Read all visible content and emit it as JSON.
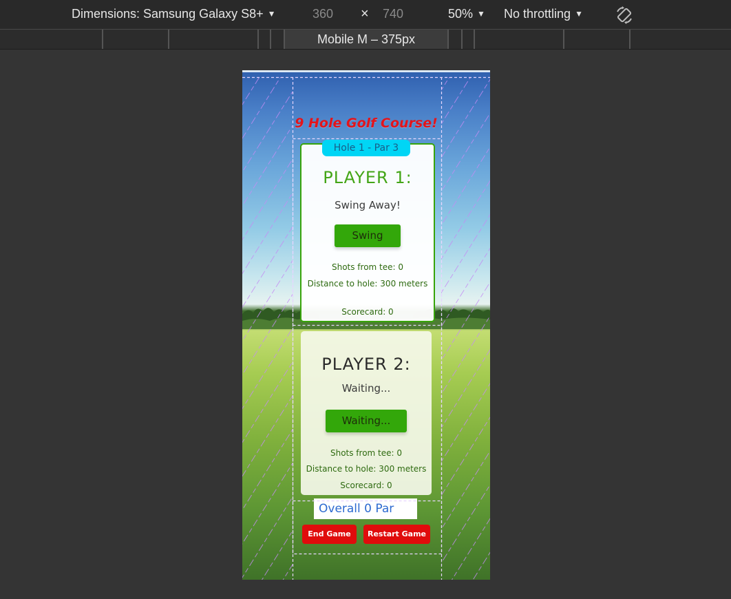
{
  "toolbar": {
    "dimensions_label": "Dimensions: Samsung Galaxy S8+",
    "width_value": "360",
    "times": "×",
    "height_value": "740",
    "zoom": "50%",
    "throttling": "No throttling",
    "rotate_icon": "rotate-icon"
  },
  "media_bar": {
    "active_label": "Mobile M – 375px"
  },
  "game": {
    "title": "9 Hole Golf Course!",
    "hole_label": "Hole 1 - Par 3",
    "player1": {
      "name": "PLAYER 1:",
      "status": "Swing Away!",
      "button": "Swing",
      "shots": "Shots from tee: 0",
      "distance": "Distance to hole: 300 meters",
      "scorecard": "Scorecard: 0"
    },
    "player2": {
      "name": "PLAYER 2:",
      "status": "Waiting...",
      "button": "Waiting...",
      "shots": "Shots from tee: 0",
      "distance": "Distance to hole: 300 meters",
      "scorecard": "Scorecard: 0"
    },
    "overall": "Overall 0 Par",
    "end_button": "End Game",
    "restart_button": "Restart Game"
  },
  "colors": {
    "title": "#e3141b",
    "hole_tab": "#00d5f5",
    "primary_button": "#33a70a",
    "danger_button": "#e00c0c",
    "grid_overlay": "#c48bf4"
  }
}
